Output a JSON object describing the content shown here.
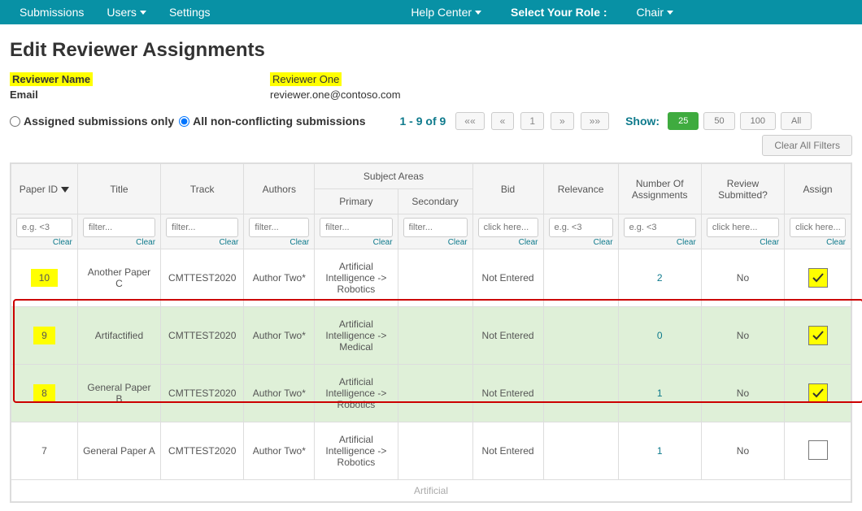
{
  "topbar": {
    "submissions": "Submissions",
    "users": "Users",
    "settings": "Settings",
    "help": "Help Center",
    "role_label": "Select Your Role :",
    "role": "Chair"
  },
  "page_title": "Edit Reviewer Assignments",
  "info": {
    "name_label": "Reviewer Name",
    "name_value": "Reviewer One",
    "email_label": "Email",
    "email_value": "reviewer.one@contoso.com"
  },
  "radios": {
    "assigned": "Assigned submissions only",
    "all": "All non-conflicting submissions"
  },
  "pager": {
    "range": "1 - 9 of 9",
    "first": "««",
    "prev": "«",
    "page": "1",
    "next": "»",
    "last": "»»"
  },
  "show": {
    "label": "Show:",
    "b25": "25",
    "b50": "50",
    "b100": "100",
    "all": "All"
  },
  "clear_all": "Clear All Filters",
  "headers": {
    "paper_id": "Paper ID",
    "title": "Title",
    "track": "Track",
    "authors": "Authors",
    "subject": "Subject Areas",
    "primary": "Primary",
    "secondary": "Secondary",
    "bid": "Bid",
    "relevance": "Relevance",
    "num_assign": "Number Of Assignments",
    "review": "Review Submitted?",
    "assign": "Assign"
  },
  "filters": {
    "eg": "e.g. <3",
    "filter": "filter...",
    "click": "click here...",
    "clear": "Clear"
  },
  "rows": [
    {
      "id": "10",
      "title": "Another Paper C",
      "track": "CMTTEST2020",
      "authors": "Author Two*",
      "primary": "Artificial Intelligence -> Robotics",
      "secondary": "",
      "bid": "Not Entered",
      "relevance": "",
      "num": "2",
      "review": "No",
      "checked": true,
      "hl_id": true,
      "hl_row": false,
      "hl_assign": true
    },
    {
      "id": "9",
      "title": "Artifactified",
      "track": "CMTTEST2020",
      "authors": "Author Two*",
      "primary": "Artificial Intelligence -> Medical",
      "secondary": "",
      "bid": "Not Entered",
      "relevance": "",
      "num": "0",
      "review": "No",
      "checked": true,
      "hl_id": true,
      "hl_row": true,
      "hl_assign": true
    },
    {
      "id": "8",
      "title": "General Paper B",
      "track": "CMTTEST2020",
      "authors": "Author Two*",
      "primary": "Artificial Intelligence -> Robotics",
      "secondary": "",
      "bid": "Not Entered",
      "relevance": "",
      "num": "1",
      "review": "No",
      "checked": true,
      "hl_id": true,
      "hl_row": true,
      "hl_assign": true
    },
    {
      "id": "7",
      "title": "General Paper A",
      "track": "CMTTEST2020",
      "authors": "Author Two*",
      "primary": "Artificial Intelligence -> Robotics",
      "secondary": "",
      "bid": "Not Entered",
      "relevance": "",
      "num": "1",
      "review": "No",
      "checked": false,
      "hl_id": false,
      "hl_row": false,
      "hl_assign": false
    }
  ]
}
